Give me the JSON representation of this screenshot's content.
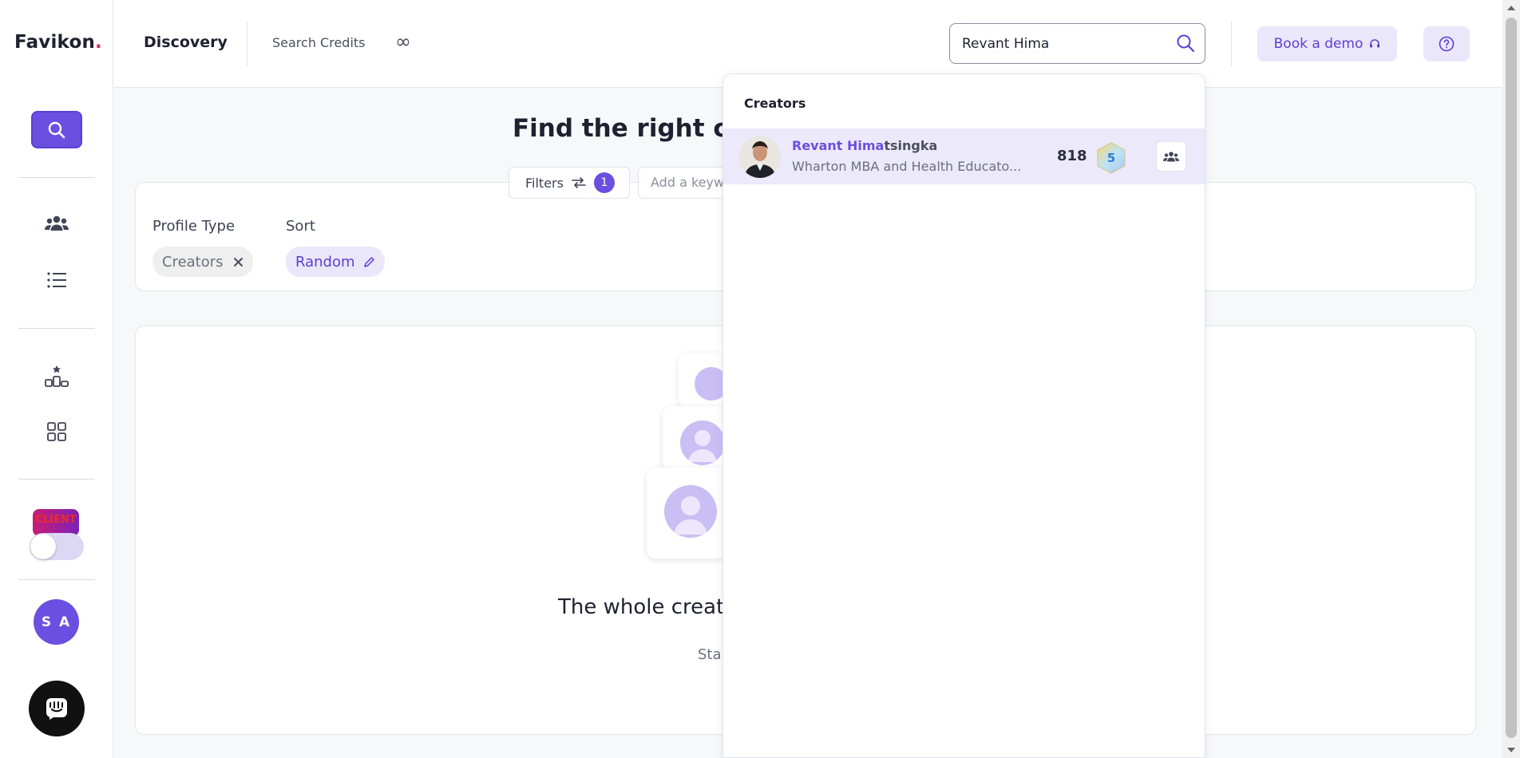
{
  "sidebar": {
    "logo_text": "Favikon",
    "logo_dot": ".",
    "client_badge": "CLIENT",
    "user_initials": "S A"
  },
  "header": {
    "title": "Discovery",
    "credits_label": "Search Credits",
    "credits_value": "∞",
    "search_value": "Revant Hima",
    "book_demo_label": "Book a demo"
  },
  "main": {
    "title": "Find the right cre",
    "filters_label": "Filters",
    "filters_count": "1",
    "keyword_placeholder": "Add a keyw",
    "profile_type_label": "Profile Type",
    "sort_label": "Sort",
    "profile_chip": "Creators",
    "sort_chip": "Random",
    "empty_heading": "The whole creat",
    "empty_sub": "Sta"
  },
  "dropdown": {
    "heading": "Creators",
    "results": [
      {
        "name_match": "Revant Hima",
        "name_rest": "tsingka",
        "description": "Wharton MBA and Health Educato...",
        "count": "818",
        "level": "5"
      }
    ]
  },
  "colors": {
    "accent": "#6a4fe0",
    "accent_light": "#ebe7fb",
    "highlight_row": "#ece9fb"
  }
}
